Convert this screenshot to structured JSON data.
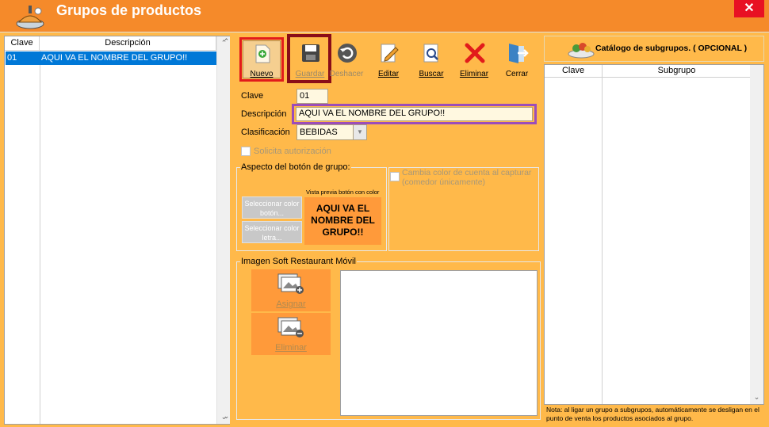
{
  "window": {
    "title": "Grupos de productos",
    "close_label": "✕"
  },
  "left_list": {
    "columns": [
      "Clave",
      "Descripción"
    ],
    "rows": [
      {
        "clave": "01",
        "descripcion": "AQUI VA EL NOMBRE DEL GRUPO!!"
      }
    ]
  },
  "toolbar": {
    "nuevo": "Nuevo",
    "guardar": "Guardar",
    "deshacer": "Deshacer",
    "editar": "Editar",
    "buscar": "Buscar",
    "eliminar": "Eliminar",
    "cerrar": "Cerrar"
  },
  "form": {
    "clave_label": "Clave",
    "clave_value": "01",
    "descripcion_label": "Descripción",
    "descripcion_value": "AQUI VA EL NOMBRE DEL GRUPO!!",
    "clasificacion_label": "Clasificación",
    "clasificacion_value": "BEBIDAS",
    "solicita_label": "Solicita autorización"
  },
  "aspecto": {
    "title": "Aspecto del botón de grupo:",
    "sel_color_boton": "Seleccionar color botón...",
    "sel_color_letra": "Seleccionar color letra...",
    "preview_caption": "Vista previa botón con color",
    "preview_text": "AQUI VA EL NOMBRE DEL GRUPO!!",
    "cambia_color_label": "Cambia color de cuenta al capturar (comedor únicamente)"
  },
  "imagen": {
    "title": "Imagen Soft Restaurant Móvil",
    "asignar": "Asignar",
    "eliminar": "Eliminar"
  },
  "subgrupos": {
    "title": "Catálogo de subgrupos. ( OPCIONAL )",
    "columns": [
      "Clave",
      "Subgrupo"
    ],
    "note": "Nota: al ligar un grupo a subgrupos, automáticamente se desligan en el punto de venta los productos asociados al grupo."
  },
  "colors": {
    "title_bar": "#f58a2a",
    "body": "#ffb94a",
    "selection": "#0078d7",
    "close": "#e81123",
    "highlight_red": "#e21b1b",
    "highlight_maroon": "#8a0d18",
    "highlight_purple": "#9b4dba"
  }
}
